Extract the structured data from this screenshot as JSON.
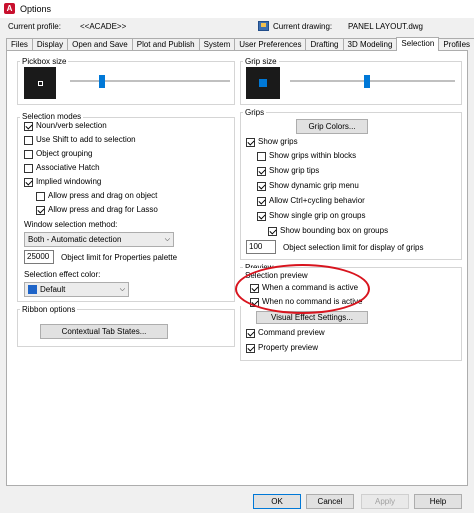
{
  "window": {
    "title": "Options",
    "app_icon_letter": "A"
  },
  "profile": {
    "label": "Current profile:",
    "value": "<<ACADE>>"
  },
  "drawing": {
    "label": "Current drawing:",
    "value": "PANEL LAYOUT.dwg"
  },
  "tabs": [
    "Files",
    "Display",
    "Open and Save",
    "Plot and Publish",
    "System",
    "User Preferences",
    "Drafting",
    "3D Modeling",
    "Selection",
    "Profiles"
  ],
  "active_tab": "Selection",
  "pickbox": {
    "label": "Pickbox size",
    "level": 0.18
  },
  "grip_size": {
    "label": "Grip size",
    "level": 0.45
  },
  "selection_modes": {
    "label": "Selection modes",
    "items": [
      {
        "label": "Noun/verb selection",
        "checked": true
      },
      {
        "label": "Use Shift to add to selection",
        "checked": false
      },
      {
        "label": "Object grouping",
        "checked": false
      },
      {
        "label": "Associative Hatch",
        "checked": false
      },
      {
        "label": "Implied windowing",
        "checked": true
      },
      {
        "label": "Allow press and drag on object",
        "checked": false
      },
      {
        "label": "Allow press and drag for Lasso",
        "checked": true
      }
    ],
    "window_method_label": "Window selection method:",
    "window_method_value": "Both - Automatic detection",
    "object_limit_value": "25000",
    "object_limit_label": "Object limit for Properties palette",
    "effect_color_label": "Selection effect color:",
    "effect_color_value": "Default",
    "effect_color_hex": "#1e64c8"
  },
  "ribbon": {
    "label": "Ribbon options",
    "button": "Contextual Tab States..."
  },
  "grips": {
    "label": "Grips",
    "colors_button": "Grip Colors...",
    "items": [
      {
        "label": "Show grips",
        "checked": true
      },
      {
        "label": "Show grips within blocks",
        "checked": false
      },
      {
        "label": "Show grip tips",
        "checked": true
      },
      {
        "label": "Show dynamic grip menu",
        "checked": true
      },
      {
        "label": "Allow Ctrl+cycling behavior",
        "checked": true
      },
      {
        "label": "Show single grip on groups",
        "checked": true
      },
      {
        "label": "Show bounding box on groups",
        "checked": true
      }
    ],
    "limit_value": "100",
    "limit_label": "Object selection limit for display of grips"
  },
  "preview": {
    "label": "Preview",
    "selection_preview_label": "Selection preview",
    "items": [
      {
        "label": "When a command is active",
        "checked": true
      },
      {
        "label": "When no command is active",
        "checked": true
      }
    ],
    "visual_button": "Visual Effect Settings...",
    "command_preview": {
      "label": "Command preview",
      "checked": true
    },
    "property_preview": {
      "label": "Property preview",
      "checked": true
    }
  },
  "footer": {
    "ok": "OK",
    "cancel": "Cancel",
    "apply": "Apply",
    "help": "Help"
  },
  "colors": {
    "accent": "#0078d7",
    "annotation_red": "#d8141e"
  }
}
